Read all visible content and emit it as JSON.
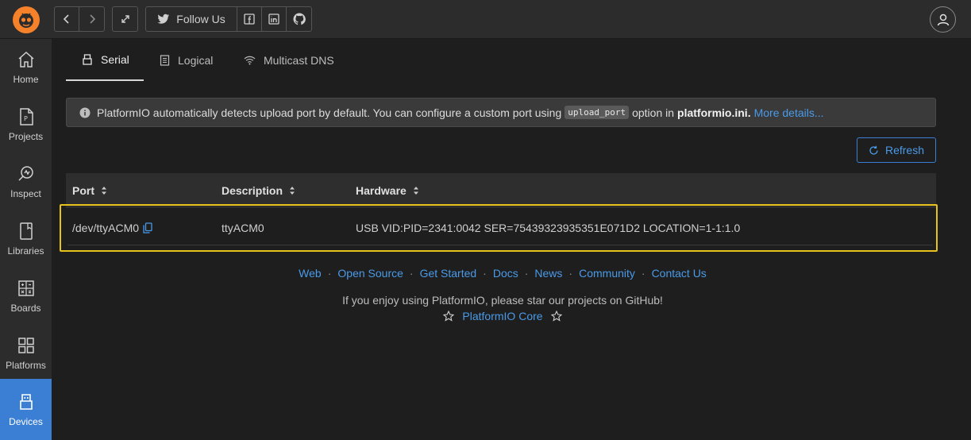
{
  "topbar": {
    "follow_label": "Follow Us"
  },
  "sidebar": {
    "items": [
      {
        "label": "Home",
        "icon": "home-icon"
      },
      {
        "label": "Projects",
        "icon": "projects-icon"
      },
      {
        "label": "Inspect",
        "icon": "inspect-icon"
      },
      {
        "label": "Libraries",
        "icon": "libraries-icon"
      },
      {
        "label": "Boards",
        "icon": "boards-icon"
      },
      {
        "label": "Platforms",
        "icon": "platforms-icon"
      },
      {
        "label": "Devices",
        "icon": "devices-icon",
        "active": true
      }
    ]
  },
  "tabs": [
    {
      "label": "Serial",
      "icon": "serial-icon",
      "active": true
    },
    {
      "label": "Logical",
      "icon": "logical-icon"
    },
    {
      "label": "Multicast DNS",
      "icon": "wifi-icon"
    }
  ],
  "alert": {
    "text": "PlatformIO automatically detects upload port by default. You can configure a custom port using",
    "code": "upload_port",
    "text2": "option in",
    "file": "platformio.ini.",
    "link": "More details..."
  },
  "refresh_label": "Refresh",
  "table": {
    "headers": [
      "Port",
      "Description",
      "Hardware"
    ],
    "rows": [
      {
        "port": "/dev/ttyACM0",
        "description": "ttyACM0",
        "hardware": "USB VID:PID=2341:0042 SER=75439323935351E071D2 LOCATION=1-1:1.0"
      }
    ]
  },
  "footer": {
    "links": [
      "Web",
      "Open Source",
      "Get Started",
      "Docs",
      "News",
      "Community",
      "Contact Us"
    ],
    "star_message": "If you enjoy using PlatformIO, please star our projects on GitHub!",
    "core_link": "PlatformIO Core"
  },
  "colors": {
    "accent": "#3a7fd4",
    "link": "#4a9ae8",
    "highlight": "#e7c21a",
    "logo": "#f5822a"
  }
}
